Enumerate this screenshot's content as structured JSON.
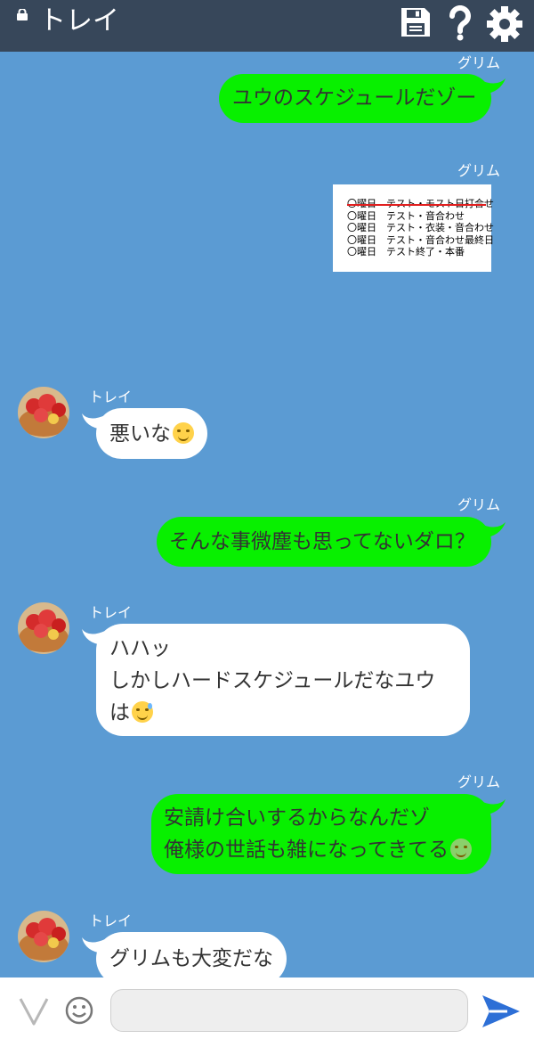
{
  "header": {
    "title": "トレイ"
  },
  "messages": [
    {
      "sender": "グリム",
      "text": "ユウのスケジュールだゾー"
    },
    {
      "sender": "グリム",
      "image_lines": [
        "〇曜日　テスト・モスト日打合せ",
        "〇曜日　テスト・音合わせ",
        "〇曜日　テスト・衣装・音合わせ",
        "〇曜日　テスト・音合わせ最終日",
        "〇曜日　テスト終了・本番"
      ]
    },
    {
      "sender": "トレイ",
      "text": "悪いな"
    },
    {
      "sender": "グリム",
      "text": "そんな事微塵も思ってないダロ？"
    },
    {
      "sender": "トレイ",
      "lines": [
        "ハハッ",
        "しかしハードスケジュールだなユウ",
        "は"
      ]
    },
    {
      "sender": "グリム",
      "lines": [
        "安請け合いするからなんだゾ",
        "俺様の世話も雑になってきてる"
      ]
    },
    {
      "sender": "トレイ",
      "text": "グリムも大変だな"
    }
  ],
  "composer": {
    "value": ""
  },
  "colors": {
    "background": "#5b9bd3",
    "header": "#37475a",
    "green_bubble": "#08f000",
    "white_bubble": "#ffffff",
    "send": "#2d6fd6"
  },
  "icons": [
    "lock-icon",
    "save-icon",
    "help-icon",
    "settings-icon",
    "sticker-icon",
    "emoji-icon",
    "send-icon"
  ]
}
